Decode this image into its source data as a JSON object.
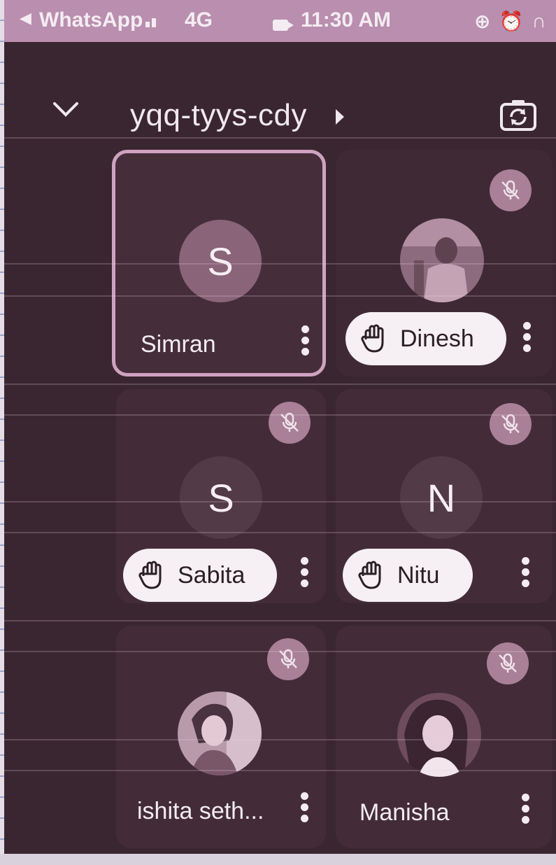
{
  "status_bar": {
    "back_app": "WhatsApp",
    "network": "4G",
    "time": "11:30 AM"
  },
  "header": {
    "meeting_code": "yqq-tyys-cdy"
  },
  "participants": [
    {
      "name": "Simran",
      "initial": "S",
      "avatar": "letter",
      "hand_raised": false,
      "muted": false,
      "active_speaker": true
    },
    {
      "name": "Dinesh",
      "initial": "",
      "avatar": "photo",
      "hand_raised": true,
      "muted": true,
      "active_speaker": false
    },
    {
      "name": "Sabita",
      "initial": "S",
      "avatar": "letter",
      "hand_raised": true,
      "muted": true,
      "active_speaker": false
    },
    {
      "name": "Nitu",
      "initial": "N",
      "avatar": "letter",
      "hand_raised": true,
      "muted": true,
      "active_speaker": false
    },
    {
      "name": "ishita seth...",
      "initial": "",
      "avatar": "photo",
      "hand_raised": false,
      "muted": true,
      "active_speaker": false
    },
    {
      "name": "Manisha",
      "initial": "",
      "avatar": "photo",
      "hand_raised": false,
      "muted": true,
      "active_speaker": false
    }
  ],
  "icons": {
    "collapse": "chevron-down-icon",
    "meeting_info": "play-arrow-icon",
    "switch_camera": "switch-camera-icon",
    "muted": "mic-off-icon",
    "hand": "raised-hand-icon",
    "options": "more-vert-icon"
  },
  "colors": {
    "status_bar": "#b98eae",
    "background": "#3a2630",
    "tile": "#432c38",
    "active_border": "#cfa2c0",
    "pill": "#f6eff3"
  }
}
